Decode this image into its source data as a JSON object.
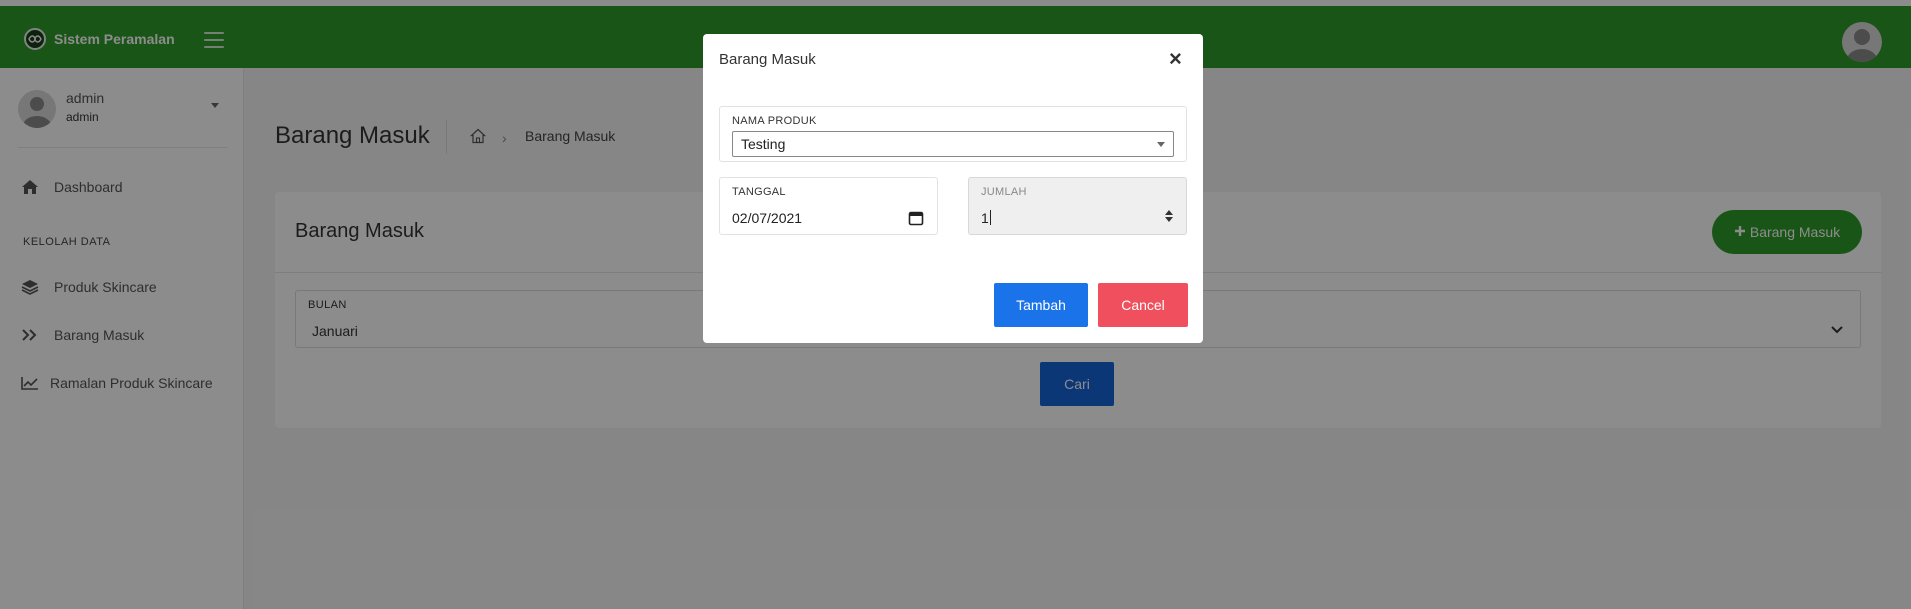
{
  "app": {
    "title": "Sistem Peramalan"
  },
  "sidebar": {
    "user": {
      "name": "admin",
      "role": "admin"
    },
    "section_label": "KELOLAH DATA",
    "items": [
      {
        "label": "Dashboard",
        "icon": "home-icon"
      },
      {
        "label": "Produk Skincare",
        "icon": "layers-icon"
      },
      {
        "label": "Barang Masuk",
        "icon": "double-chevron-right-icon"
      },
      {
        "label": "Ramalan Produk Skincare",
        "icon": "line-chart-icon"
      }
    ]
  },
  "page": {
    "title": "Barang Masuk",
    "breadcrumb_current": "Barang Masuk"
  },
  "card": {
    "title": "Barang Masuk",
    "add_button": "Barang Masuk",
    "filter_label": "BULAN",
    "filter_value": "Januari",
    "search_button": "Cari"
  },
  "modal": {
    "title": "Barang Masuk",
    "close": "×",
    "product_label": "NAMA PRODUK",
    "product_value": "Testing",
    "date_label": "TANGGAL",
    "date_value": "02/07/2021",
    "qty_label": "JUMLAH",
    "qty_value": "1",
    "submit_button": "Tambah",
    "cancel_button": "Cancel"
  },
  "colors": {
    "brand_green": "#2f9b2a",
    "primary_blue": "#1a73e8",
    "danger_red": "#f0505d"
  }
}
